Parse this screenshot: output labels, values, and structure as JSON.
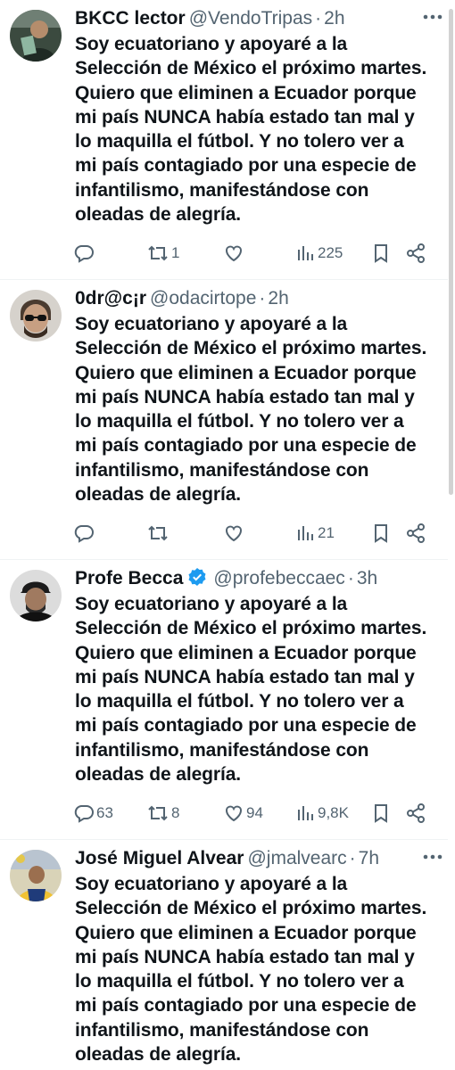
{
  "tweets": [
    {
      "name": "BKCC lector",
      "handle": "@VendoTripas",
      "separator": "·",
      "time": "2h",
      "verified": false,
      "text": "Soy ecuatoriano y apoyaré a la\nSelección de México el próximo martes.\nQuiero que eliminen a Ecuador porque\nmi país NUNCA había estado tan mal y\nlo maquilla el fútbol. Y no tolero ver a\nmi país contagiado por una especie de\ninfantilismo, manifestándose con\noleadas de alegría.",
      "replies": "",
      "retweets": "1",
      "likes": "",
      "views": "225",
      "avatar_icon": "avatar-person-icon"
    },
    {
      "name": "0dr@c¡r",
      "handle": "@odacirtope",
      "separator": "·",
      "time": "2h",
      "verified": false,
      "text": "Soy ecuatoriano y apoyaré a la\nSelección de México el próximo martes.\nQuiero que eliminen a Ecuador porque\nmi país NUNCA había estado tan mal y\nlo maquilla el fútbol. Y no tolero ver a\nmi país contagiado por una especie de\ninfantilismo, manifestándose con\noleadas de alegría.",
      "replies": "",
      "retweets": "",
      "likes": "",
      "views": "21",
      "avatar_icon": "avatar-person-icon"
    },
    {
      "name": "Profe Becca",
      "handle": "@profebeccaec",
      "separator": "·",
      "time": "3h",
      "verified": true,
      "text": "Soy ecuatoriano y apoyaré a la\nSelección de México el próximo martes.\nQuiero que eliminen a Ecuador porque\nmi país NUNCA había estado tan mal y\nlo maquilla el fútbol. Y no tolero ver a\nmi país contagiado por una especie de\ninfantilismo, manifestándose con\noleadas de alegría.",
      "replies": "63",
      "retweets": "8",
      "likes": "94",
      "views": "9,8K",
      "avatar_icon": "avatar-person-icon"
    },
    {
      "name": "José Miguel Alvear",
      "handle": "@jmalvearc",
      "separator": "·",
      "time": "7h",
      "verified": false,
      "text": "Soy ecuatoriano y apoyaré a la\nSelección de México el próximo martes.\nQuiero que eliminen a Ecuador porque\nmi país NUNCA había estado tan mal y\nlo maquilla el fútbol. Y no tolero ver a\nmi país contagiado por una especie de\ninfantilismo, manifestándose con\noleadas de alegría.",
      "replies": "",
      "retweets": "",
      "likes": "",
      "views": "",
      "avatar_icon": "avatar-person-icon"
    }
  ],
  "colors": {
    "text_primary": "#0f1419",
    "text_secondary": "#536471",
    "verified_badge": "#1d9bf0",
    "divider": "#eff3f4"
  }
}
